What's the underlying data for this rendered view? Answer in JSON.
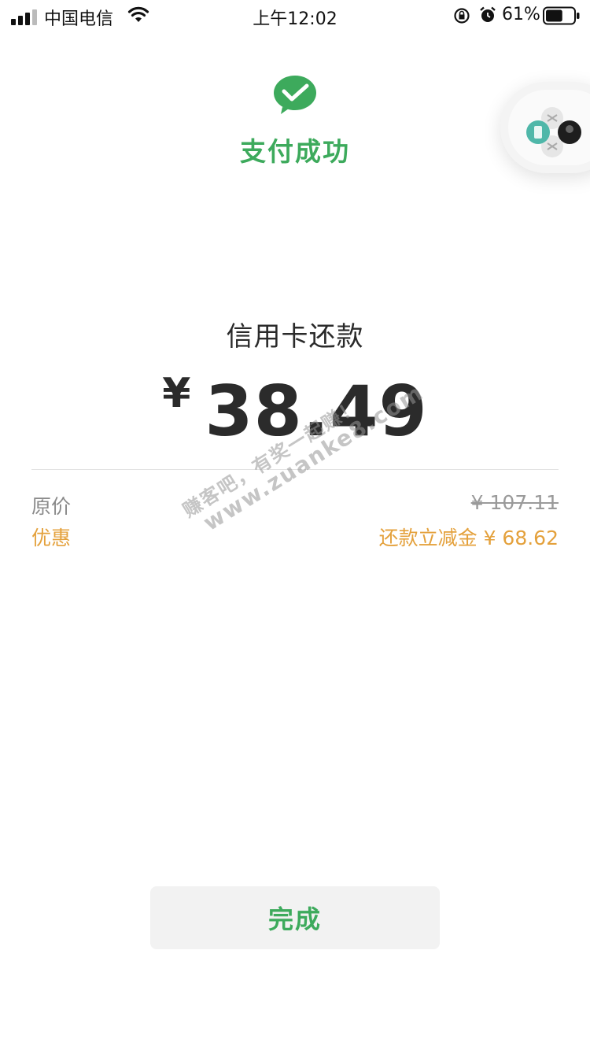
{
  "status_bar": {
    "carrier": "中国电信",
    "time": "上午12:02",
    "battery_percent": "61%",
    "signal_bars": 3,
    "battery_level": 0.61
  },
  "header": {
    "logo_icon": "wechat-pay-icon",
    "title": "支付成功",
    "accent_color": "#3daa5c"
  },
  "payment": {
    "merchant": "信用卡还款",
    "currency_symbol": "¥",
    "amount": "38.49"
  },
  "details": {
    "original_label": "原价",
    "original_value": "¥ 107.11",
    "discount_label": "优惠",
    "discount_value": "还款立减金 ¥ 68.62",
    "discount_color": "#e4a13c"
  },
  "watermark": {
    "line1": "赚客吧，有奖一起赚！",
    "line2": "www.zuanke8.com"
  },
  "actions": {
    "done_label": "完成"
  }
}
